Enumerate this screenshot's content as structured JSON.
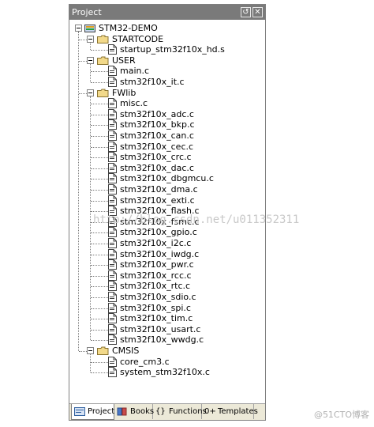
{
  "panel": {
    "title": "Project",
    "pin_glyph": "↺",
    "close_glyph": "✕"
  },
  "tree": {
    "root": {
      "label": "STM32-DEMO",
      "icon": "project-icon"
    },
    "groups": [
      {
        "label": "STARTCODE",
        "files": [
          "startup_stm32f10x_hd.s"
        ]
      },
      {
        "label": "USER",
        "files": [
          "main.c",
          "stm32f10x_it.c"
        ]
      },
      {
        "label": "FWlib",
        "files": [
          "misc.c",
          "stm32f10x_adc.c",
          "stm32f10x_bkp.c",
          "stm32f10x_can.c",
          "stm32f10x_cec.c",
          "stm32f10x_crc.c",
          "stm32f10x_dac.c",
          "stm32f10x_dbgmcu.c",
          "stm32f10x_dma.c",
          "stm32f10x_exti.c",
          "stm32f10x_flash.c",
          "stm32f10x_fsmc.c",
          "stm32f10x_gpio.c",
          "stm32f10x_i2c.c",
          "stm32f10x_iwdg.c",
          "stm32f10x_pwr.c",
          "stm32f10x_rcc.c",
          "stm32f10x_rtc.c",
          "stm32f10x_sdio.c",
          "stm32f10x_spi.c",
          "stm32f10x_tim.c",
          "stm32f10x_usart.c",
          "stm32f10x_wwdg.c"
        ]
      },
      {
        "label": "CMSIS",
        "files": [
          "core_cm3.c",
          "system_stm32f10x.c"
        ]
      }
    ]
  },
  "tabs": [
    {
      "label": "Project",
      "icon": "project-tab-icon",
      "active": true
    },
    {
      "label": "Books",
      "icon": "books-icon",
      "active": false
    },
    {
      "label": "Functions",
      "icon": "functions-icon",
      "active": false
    },
    {
      "label": "Templates",
      "icon": "templates-icon",
      "active": false
    }
  ],
  "tab_glyphs": {
    "functions": "{}",
    "templates": "0+"
  },
  "watermark": "http://blog.csdn.net/u011352311",
  "corner_mark": "@51CTO博客",
  "colors": {
    "titlebar": "#7a7a7a",
    "folder": "#f2d98a",
    "tab_bar": "#ece9d8"
  }
}
